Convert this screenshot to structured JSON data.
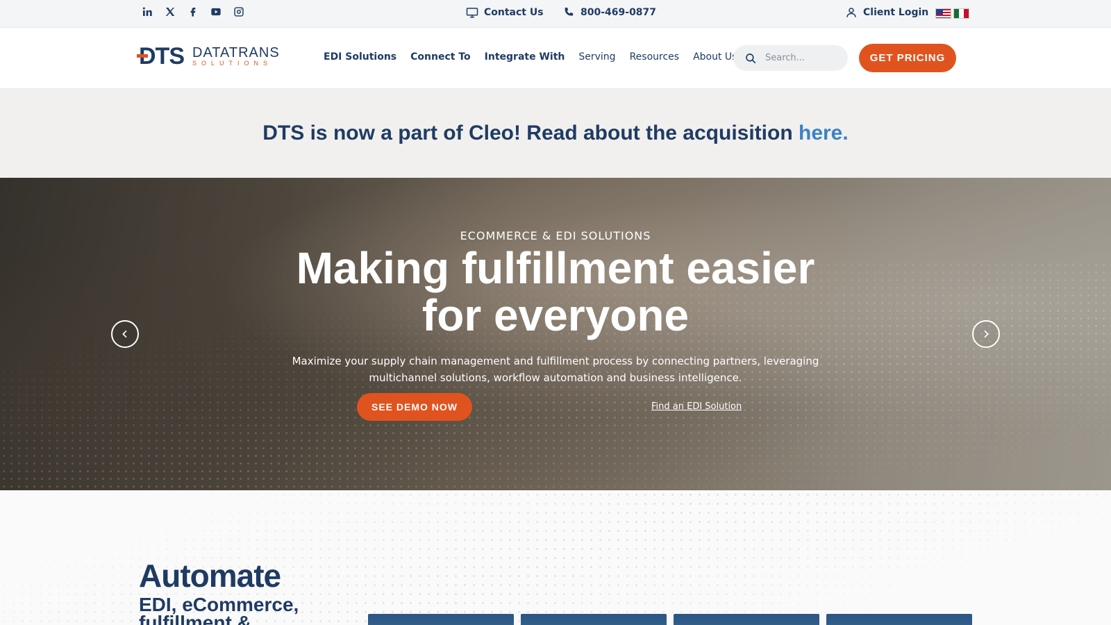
{
  "topbar": {
    "social_icons": [
      "linkedin-icon",
      "x-twitter-icon",
      "facebook-icon",
      "youtube-icon",
      "instagram-icon"
    ],
    "contact_label": "Contact Us",
    "phone_label": "800-469-0877",
    "client_login_label": "Client Login",
    "languages": [
      "English (US flag)",
      "Spanish (Mexico flag)"
    ]
  },
  "header": {
    "logo": {
      "mark": "DTS",
      "word": "DATATRANS",
      "subword": "SOLUTIONS"
    },
    "nav": [
      {
        "label": "EDI Solutions"
      },
      {
        "label": "Connect To"
      },
      {
        "label": "Integrate With"
      },
      {
        "label": "Serving"
      },
      {
        "label": "Resources"
      },
      {
        "label": "About Us"
      }
    ],
    "search_placeholder": "Search...",
    "pricing_label": "GET PRICING"
  },
  "announcement": {
    "text": "DTS is now a part of Cleo! Read about the acquisition ",
    "link_label": "here."
  },
  "hero": {
    "eyebrow": "ECOMMERCE & EDI SOLUTIONS",
    "title_line1": "Making fulfillment easier",
    "title_line2": "for everyone",
    "description": "Maximize your supply chain management and fulfillment process by connecting partners, leveraging multichannel solutions, workflow automation and business intelligence.",
    "demo_label": "SEE DEMO NOW",
    "find_link_label": "Find an EDI Solution"
  },
  "automate": {
    "title": "Automate",
    "subtitle": "EDI, eCommerce, fulfillment &"
  },
  "colors": {
    "navy": "#1f3b63",
    "accent_orange": "#e0531f",
    "link_blue": "#3b82c4",
    "announcement_bg": "#f1f0ee"
  }
}
